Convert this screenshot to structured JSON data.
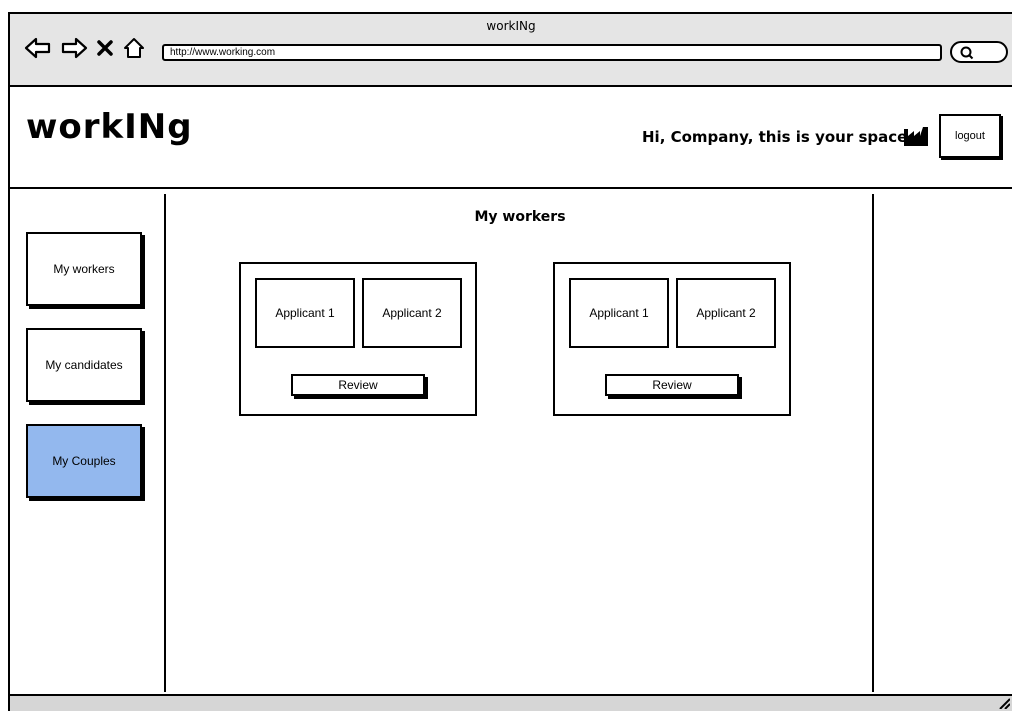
{
  "browser": {
    "window_title": "workINg",
    "url": "http://www.working.com"
  },
  "icons": {
    "back": "arrow-left-icon",
    "forward": "arrow-right-icon",
    "stop": "close-icon",
    "home": "home-icon",
    "search": "search-icon",
    "company": "factory-icon",
    "resize": "resize-grip-icon"
  },
  "header": {
    "brand": "workINg",
    "greeting": "Hi, Company, this is your space",
    "logout_label": "logout"
  },
  "sidebar": {
    "items": [
      {
        "label": "My workers",
        "active": false
      },
      {
        "label": "My candidates",
        "active": false
      },
      {
        "label": "My Couples",
        "active": true
      }
    ]
  },
  "main": {
    "title": "My workers",
    "couples": [
      {
        "applicant1": "Applicant 1",
        "applicant2": "Applicant 2",
        "review_label": "Review"
      },
      {
        "applicant1": "Applicant 1",
        "applicant2": "Applicant 2",
        "review_label": "Review"
      }
    ]
  },
  "colors": {
    "active_nav": "#93b8ee",
    "chrome_bg": "#e5e5e5"
  }
}
